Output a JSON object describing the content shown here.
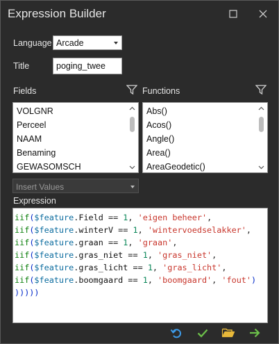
{
  "window": {
    "title": "Expression Builder"
  },
  "language": {
    "label": "Language",
    "value": "Arcade"
  },
  "title_field": {
    "label": "Title",
    "value": "poging_twee"
  },
  "fields": {
    "label": "Fields",
    "items": [
      "VOLGNR",
      "Perceel",
      "NAAM",
      "Benaming",
      "GEWASOMSCH"
    ]
  },
  "functions": {
    "label": "Functions",
    "items": [
      "Abs()",
      "Acos()",
      "Angle()",
      "Area()",
      "AreaGeodetic()"
    ]
  },
  "insert_values": {
    "placeholder": "Insert Values"
  },
  "expression": {
    "label": "Expression",
    "lines": [
      [
        [
          "fn",
          "iif"
        ],
        [
          "paren",
          "("
        ],
        [
          "var",
          "$feature"
        ],
        [
          "fld",
          ".Field"
        ],
        [
          "op",
          " == "
        ],
        [
          "num",
          "1"
        ],
        [
          "op",
          ", "
        ],
        [
          "str",
          "'eigen beheer'"
        ],
        [
          "op",
          ","
        ]
      ],
      [
        [
          "fn",
          "iif"
        ],
        [
          "paren",
          "("
        ],
        [
          "var",
          "$feature"
        ],
        [
          "fld",
          ".winterV"
        ],
        [
          "op",
          " == "
        ],
        [
          "num",
          "1"
        ],
        [
          "op",
          ", "
        ],
        [
          "str",
          "'wintervoedselakker'"
        ],
        [
          "op",
          ","
        ]
      ],
      [
        [
          "fn",
          "iif"
        ],
        [
          "paren",
          "("
        ],
        [
          "var",
          "$feature"
        ],
        [
          "fld",
          ".graan"
        ],
        [
          "op",
          " == "
        ],
        [
          "num",
          "1"
        ],
        [
          "op",
          ", "
        ],
        [
          "str",
          "'graan'"
        ],
        [
          "op",
          ","
        ]
      ],
      [
        [
          "fn",
          "iif"
        ],
        [
          "paren",
          "("
        ],
        [
          "var",
          "$feature"
        ],
        [
          "fld",
          ".gras_niet"
        ],
        [
          "op",
          " == "
        ],
        [
          "num",
          "1"
        ],
        [
          "op",
          ", "
        ],
        [
          "str",
          "'gras_niet'"
        ],
        [
          "op",
          ","
        ]
      ],
      [
        [
          "fn",
          "iif"
        ],
        [
          "paren",
          "("
        ],
        [
          "var",
          "$feature"
        ],
        [
          "fld",
          ".gras_licht"
        ],
        [
          "op",
          " == "
        ],
        [
          "num",
          "1"
        ],
        [
          "op",
          ", "
        ],
        [
          "str",
          "'gras_licht'"
        ],
        [
          "op",
          ","
        ]
      ],
      [
        [
          "fn",
          "iif"
        ],
        [
          "paren",
          "("
        ],
        [
          "var",
          "$feature"
        ],
        [
          "fld",
          ".boomgaard"
        ],
        [
          "op",
          " == "
        ],
        [
          "num",
          "1"
        ],
        [
          "op",
          ", "
        ],
        [
          "str",
          "'boomgaard'"
        ],
        [
          "op",
          ", "
        ],
        [
          "str",
          "'fout'"
        ],
        [
          "paren",
          ")"
        ]
      ],
      [
        [
          "paren",
          ")))))"
        ]
      ]
    ]
  },
  "colors": {
    "background": "#2b2b2b",
    "accent_blue": "#3d9be9",
    "accent_green": "#6cc04a",
    "folder_yellow": "#e8b93a"
  },
  "footer": {
    "icons": [
      "undo-icon",
      "check-icon",
      "folder-open-icon",
      "arrow-right-icon"
    ]
  }
}
